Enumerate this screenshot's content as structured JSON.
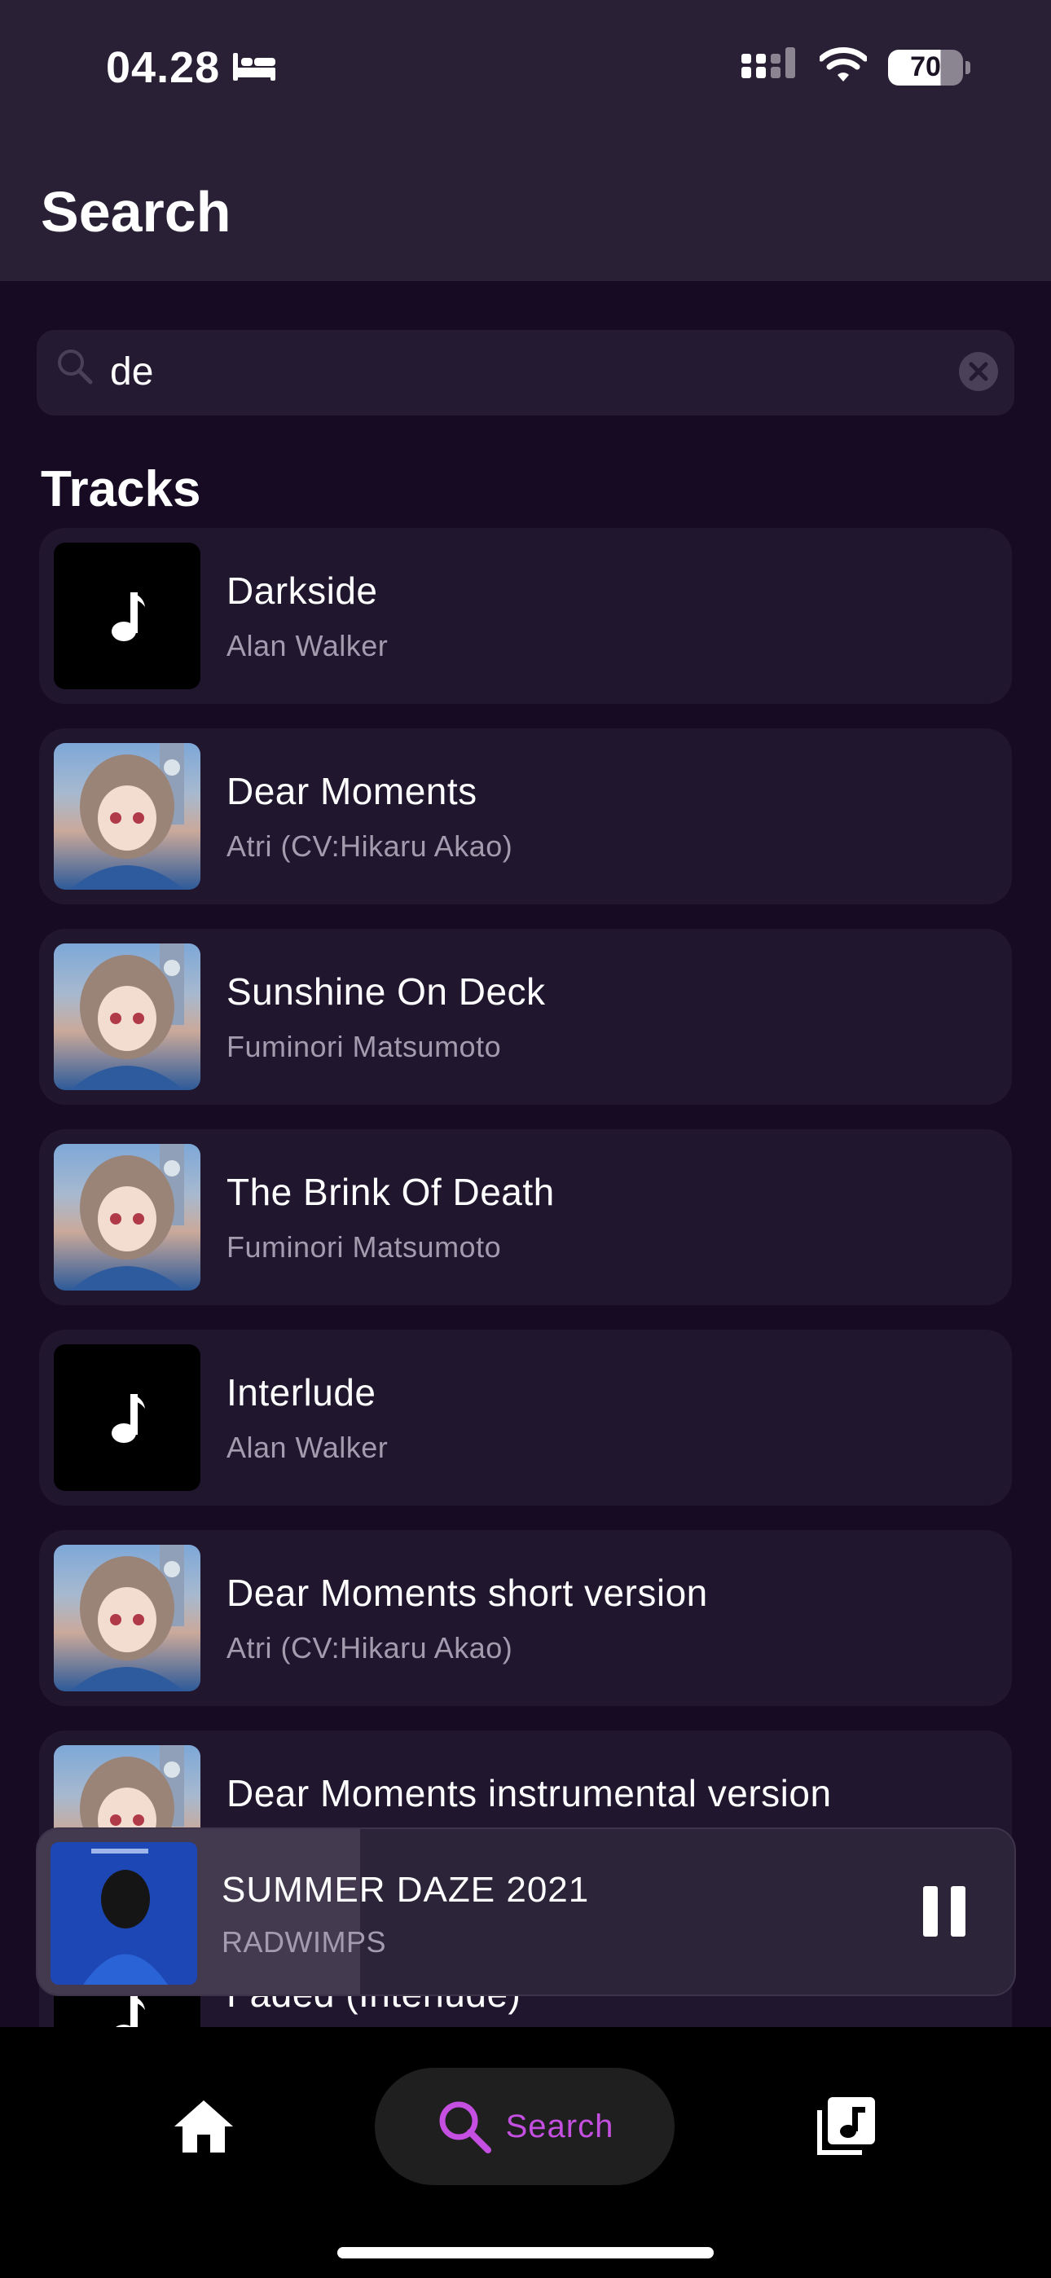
{
  "status_bar": {
    "time": "04.28",
    "battery": "70"
  },
  "header": {
    "title": "Search"
  },
  "search": {
    "value": "de"
  },
  "tracks_section": {
    "title": "Tracks"
  },
  "tracks": [
    {
      "title": "Darkside",
      "artist": "Alan Walker",
      "art": "music-note-icon"
    },
    {
      "title": "Dear Moments",
      "artist": "Atri (CV:Hikaru Akao)",
      "art": "album-art"
    },
    {
      "title": "Sunshine On Deck",
      "artist": "Fuminori Matsumoto",
      "art": "album-art"
    },
    {
      "title": "The Brink Of Death",
      "artist": "Fuminori Matsumoto",
      "art": "album-art"
    },
    {
      "title": "Interlude",
      "artist": "Alan Walker",
      "art": "music-note-icon"
    },
    {
      "title": "Dear Moments short version",
      "artist": "Atri (CV:Hikaru Akao)",
      "art": "album-art"
    },
    {
      "title": "Dear Moments instrumental version",
      "artist": "",
      "art": "album-art"
    },
    {
      "title": "Faded (Interlude)",
      "artist": "",
      "art": "music-note-icon"
    }
  ],
  "now_playing": {
    "title": "SUMMER DAZE 2021",
    "artist": "RADWIMPS",
    "progress_fraction": 0.33
  },
  "nav": {
    "search_label": "Search"
  },
  "colors": {
    "accent": "#c44fe0",
    "background": "#170b24",
    "card": "#20162e",
    "header": "#2a2036"
  }
}
